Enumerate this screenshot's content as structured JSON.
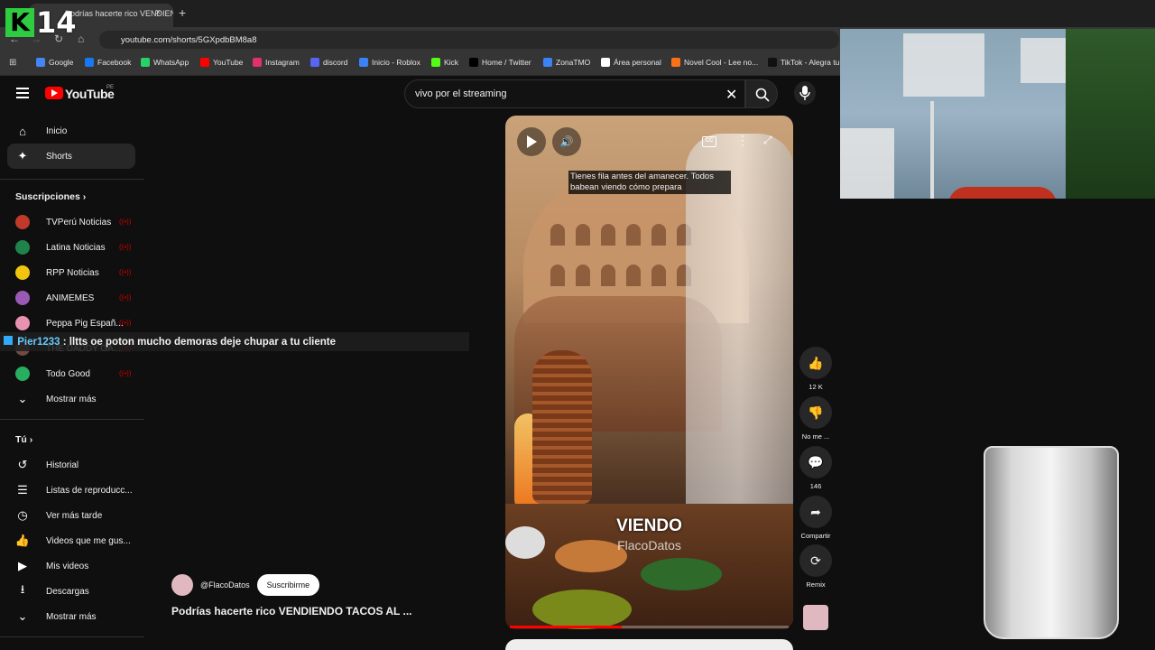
{
  "stream_overlay": {
    "logo_letter": "K",
    "number": "14"
  },
  "browser": {
    "tab_title": "Podrías hacerte rico VENDIENDO",
    "tab_close": "×",
    "new_tab": "+",
    "url": "youtube.com/shorts/5GXpdbBM8a8",
    "bookmarks": [
      {
        "label": "Google",
        "color": "#4285f4"
      },
      {
        "label": "Facebook",
        "color": "#1877f2"
      },
      {
        "label": "WhatsApp",
        "color": "#25d366"
      },
      {
        "label": "YouTube",
        "color": "#ff0000"
      },
      {
        "label": "Instagram",
        "color": "#e1306c"
      },
      {
        "label": "discord",
        "color": "#5865f2"
      },
      {
        "label": "Inicio - Roblox",
        "color": "#3b82f6"
      },
      {
        "label": "Kick",
        "color": "#53fc18"
      },
      {
        "label": "Home / Twitter",
        "color": "#000000"
      },
      {
        "label": "ZonaTMO",
        "color": "#3b82f6"
      },
      {
        "label": "Área personal",
        "color": "#ffffff"
      },
      {
        "label": "Novel Cool - Lee no...",
        "color": "#f97316"
      },
      {
        "label": "TikTok - Alegra tu",
        "color": "#111111"
      }
    ]
  },
  "youtube": {
    "logo_text": "YouTube",
    "country": "PE",
    "search_query": "vivo por el streaming",
    "nav": [
      {
        "label": "Inicio",
        "icon": "home-icon"
      },
      {
        "label": "Shorts",
        "icon": "shorts-icon",
        "selected": true
      }
    ],
    "subscriptions_title": "Suscripciones",
    "subscriptions": [
      {
        "label": "TVPerú Noticias",
        "color": "#c0392b"
      },
      {
        "label": "Latina Noticias",
        "color": "#1e8449"
      },
      {
        "label": "RPP Noticias",
        "color": "#f1c40f"
      },
      {
        "label": "ANIMEMES",
        "color": "#9b59b6"
      },
      {
        "label": "Peppa Pig Españ...",
        "color": "#e991b0"
      },
      {
        "label": "THE DADDY GA...",
        "color": "#6d4c41"
      },
      {
        "label": "Todo Good",
        "color": "#27ae60"
      }
    ],
    "show_more": "Mostrar más",
    "you_title": "Tú",
    "you_items": [
      {
        "label": "Historial",
        "icon": "history-icon"
      },
      {
        "label": "Listas de reproducc...",
        "icon": "playlist-icon"
      },
      {
        "label": "Ver más tarde",
        "icon": "clock-icon"
      },
      {
        "label": "Videos que me gus...",
        "icon": "like-icon"
      },
      {
        "label": "Mis videos",
        "icon": "video-icon"
      },
      {
        "label": "Descargas",
        "icon": "download-icon"
      }
    ],
    "show_more_2": "Mostrar más"
  },
  "chat": {
    "username": "Pier1233",
    "message": ": lltts oe poton mucho demoras deje chupar a tu cliente"
  },
  "short": {
    "subtitle": "Tienes fila antes del amanecer. Todos babean viendo cómo prepara",
    "caption_big": "VIENDO",
    "watermark": "FlacoDatos",
    "progress": 0.4,
    "actions": [
      {
        "label": "12 K",
        "icon": "thumb-up-icon",
        "glyph": "👍"
      },
      {
        "label": "No me ...",
        "icon": "thumb-down-icon",
        "glyph": "👎"
      },
      {
        "label": "146",
        "icon": "comment-icon",
        "glyph": "💬"
      },
      {
        "label": "Compartir",
        "icon": "share-icon",
        "glyph": "➦"
      },
      {
        "label": "Remix",
        "icon": "remix-icon",
        "glyph": "⟳"
      }
    ],
    "channel": "@FlacoDatos",
    "subscribe": "Suscribirme",
    "title": "Podrías hacerte rico VENDIENDO TACOS AL ..."
  }
}
